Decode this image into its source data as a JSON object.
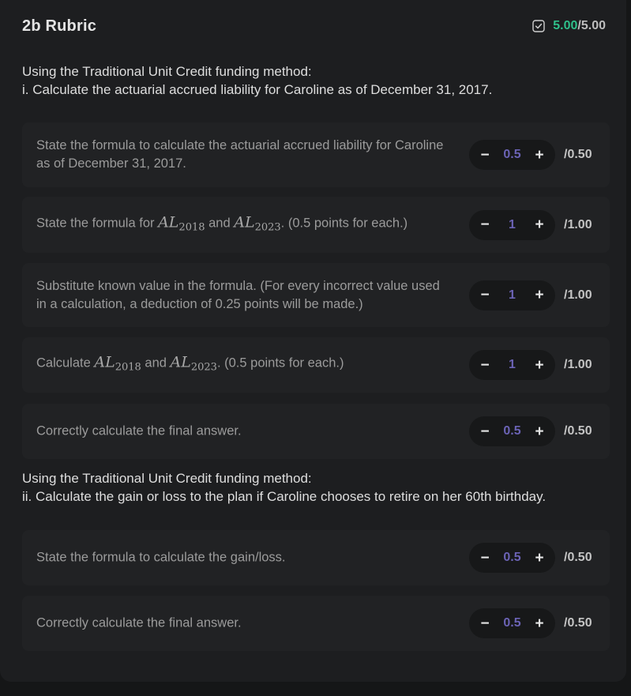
{
  "header": {
    "title": "2b Rubric",
    "score_earned": "5.00",
    "score_total": "/5.00",
    "icon": "checkbox-checked-icon",
    "colors": {
      "earned": "#2fbf8a",
      "stepper_value": "#6b63b5"
    }
  },
  "sections": [
    {
      "line1": "Using the Traditional Unit Credit funding method:",
      "line2": "i. Calculate the actuarial accrued liability for Caroline as of December 31, 2017.",
      "items": [
        {
          "text": "State the formula to calculate the actuarial accrued liability for Caroline as of December 31, 2017.",
          "value": "0.5",
          "max": "/0.50"
        },
        {
          "text_before": "State the formula for ",
          "math1_base": "AL",
          "math1_sub": "2018",
          "text_mid": " and ",
          "math2_base": "AL",
          "math2_sub": "2023",
          "text_after": ". (0.5 points for each.)",
          "value": "1",
          "max": "/1.00"
        },
        {
          "text": "Substitute known value in the formula. (For every incorrect value used in a calculation, a deduction of 0.25 points will be made.)",
          "value": "1",
          "max": "/1.00"
        },
        {
          "text_before": "Calculate ",
          "math1_base": "AL",
          "math1_sub": "2018",
          "text_mid": " and ",
          "math2_base": "AL",
          "math2_sub": "2023",
          "text_after": ". (0.5 points for each.)",
          "value": "1",
          "max": "/1.00"
        },
        {
          "text": "Correctly calculate the final answer.",
          "value": "0.5",
          "max": "/0.50"
        }
      ]
    },
    {
      "line1": "Using the Traditional Unit Credit funding method:",
      "line2": "ii. Calculate the gain or loss to the plan if Caroline chooses to retire on her 60th birthday.",
      "items": [
        {
          "text": "State the formula to calculate the gain/loss.",
          "value": "0.5",
          "max": "/0.50"
        },
        {
          "text": "Correctly calculate the final answer.",
          "value": "0.5",
          "max": "/0.50"
        }
      ]
    }
  ],
  "stepper": {
    "minus": "−",
    "plus": "+"
  }
}
